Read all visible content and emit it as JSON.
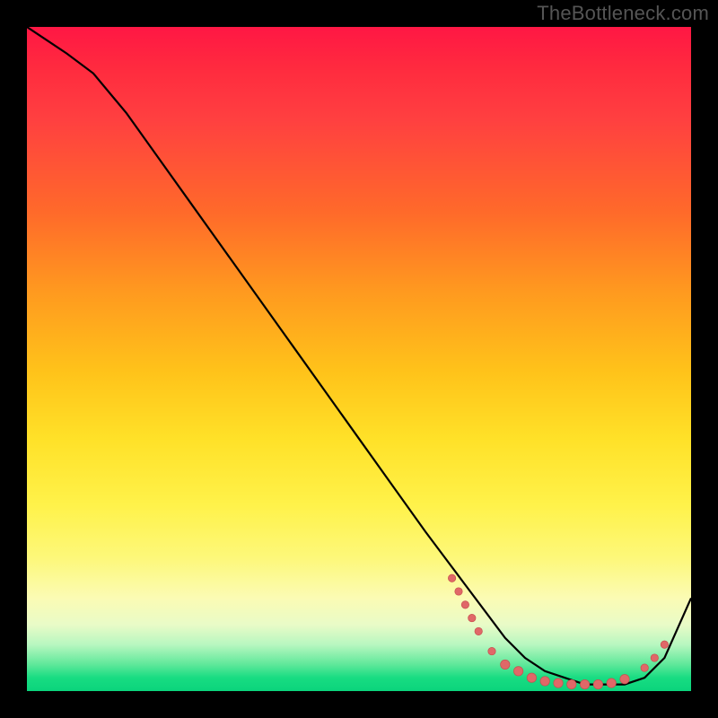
{
  "watermark": "TheBottleneck.com",
  "chart_data": {
    "type": "line",
    "title": "",
    "xlabel": "",
    "ylabel": "",
    "xlim": [
      0,
      100
    ],
    "ylim": [
      0,
      100
    ],
    "grid": false,
    "legend": false,
    "background_gradient": {
      "direction": "vertical",
      "stops": [
        {
          "pos": 0,
          "color": "#ff1744"
        },
        {
          "pos": 14,
          "color": "#ff4040"
        },
        {
          "pos": 28,
          "color": "#ff6a2a"
        },
        {
          "pos": 40,
          "color": "#ff9a1f"
        },
        {
          "pos": 52,
          "color": "#ffc31a"
        },
        {
          "pos": 62,
          "color": "#ffe128"
        },
        {
          "pos": 72,
          "color": "#fff24a"
        },
        {
          "pos": 86,
          "color": "#fbfbb4"
        },
        {
          "pos": 93,
          "color": "#b8f7c0"
        },
        {
          "pos": 100,
          "color": "#0bd47c"
        }
      ]
    },
    "series": [
      {
        "name": "bottleneck-curve",
        "x": [
          0,
          3,
          6,
          10,
          15,
          20,
          25,
          30,
          35,
          40,
          45,
          50,
          55,
          60,
          63,
          66,
          69,
          72,
          75,
          78,
          81,
          84,
          87,
          90,
          93,
          96,
          100
        ],
        "y": [
          100,
          98,
          96,
          93,
          87,
          80,
          73,
          66,
          59,
          52,
          45,
          38,
          31,
          24,
          20,
          16,
          12,
          8,
          5,
          3,
          2,
          1,
          1,
          1,
          2,
          5,
          14
        ]
      }
    ],
    "markers": {
      "name": "highlight-points",
      "color": "#e06868",
      "points": [
        {
          "x": 64,
          "y": 17
        },
        {
          "x": 65,
          "y": 15
        },
        {
          "x": 66,
          "y": 13
        },
        {
          "x": 67,
          "y": 11
        },
        {
          "x": 68,
          "y": 9
        },
        {
          "x": 70,
          "y": 6
        },
        {
          "x": 72,
          "y": 4
        },
        {
          "x": 74,
          "y": 3
        },
        {
          "x": 76,
          "y": 2
        },
        {
          "x": 78,
          "y": 1.5
        },
        {
          "x": 80,
          "y": 1.2
        },
        {
          "x": 82,
          "y": 1.0
        },
        {
          "x": 84,
          "y": 1.0
        },
        {
          "x": 86,
          "y": 1.0
        },
        {
          "x": 88,
          "y": 1.2
        },
        {
          "x": 90,
          "y": 1.8
        },
        {
          "x": 93,
          "y": 3.5
        },
        {
          "x": 94.5,
          "y": 5.0
        },
        {
          "x": 96,
          "y": 7.0
        }
      ]
    }
  }
}
